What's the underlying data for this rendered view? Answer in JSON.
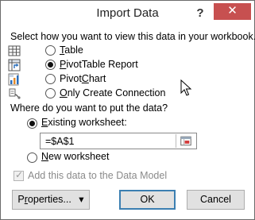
{
  "window": {
    "title": "Import Data",
    "help_label": "?",
    "close_label": "✕"
  },
  "view": {
    "prompt": "Select how you want to view this data in your workbook.",
    "options": [
      {
        "accel": "T",
        "rest": "able",
        "icon": "table-icon",
        "selected": false
      },
      {
        "accel": "P",
        "rest": "ivotTable Report",
        "icon": "pivottable-icon",
        "selected": true
      },
      {
        "pre": "Pivot",
        "accel": "C",
        "rest": "hart",
        "icon": "pivotchart-icon",
        "selected": false
      },
      {
        "accel": "O",
        "rest": "nly Create Connection",
        "icon": "connection-icon",
        "selected": false
      }
    ]
  },
  "destination": {
    "prompt": "Where do you want to put the data?",
    "existing": {
      "accel": "E",
      "rest": "xisting worksheet:",
      "selected": true
    },
    "reference_value": "=$A$1",
    "new": {
      "accel": "N",
      "rest": "ew worksheet",
      "selected": false
    }
  },
  "data_model": {
    "label": "Add this data to the Data Model",
    "checked": true,
    "disabled": true
  },
  "buttons": {
    "properties": {
      "pre": "P",
      "accel": "r",
      "rest": "operties...",
      "arrow": "▾"
    },
    "ok": "OK",
    "cancel": "Cancel"
  }
}
